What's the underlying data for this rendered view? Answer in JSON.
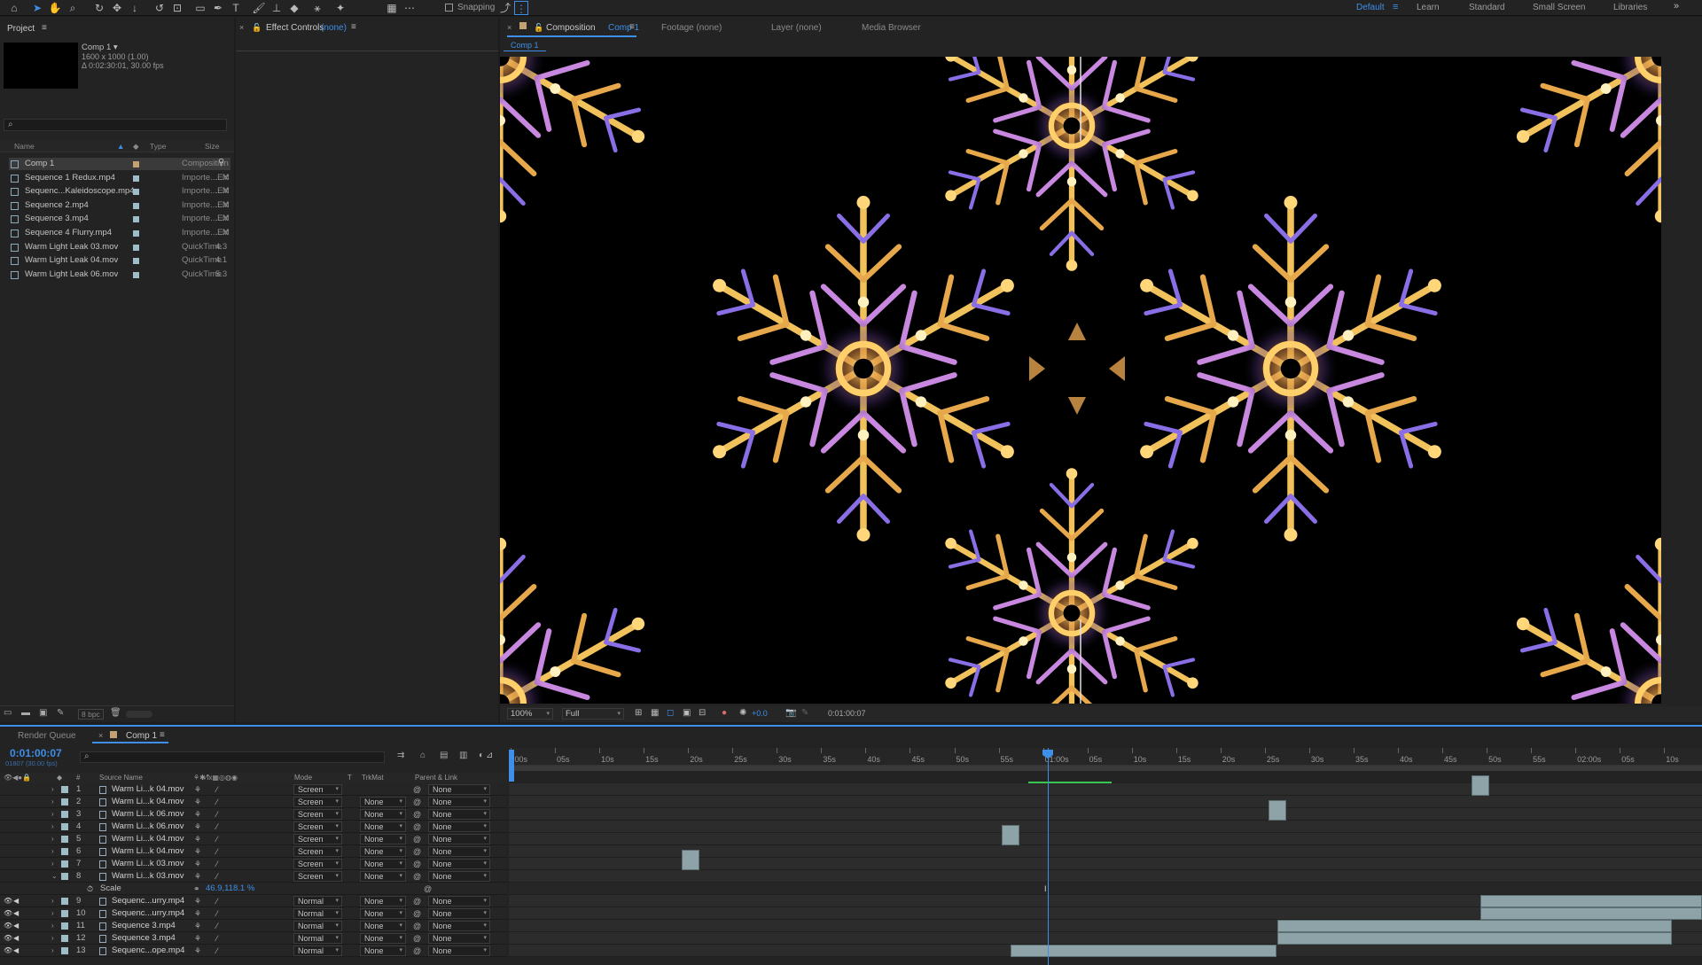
{
  "toolbar": {
    "snapping_label": "Snapping",
    "workspaces": [
      "Default",
      "Learn",
      "Standard",
      "Small Screen",
      "Libraries"
    ],
    "active_workspace": "Default"
  },
  "project": {
    "tab_label": "Project",
    "comp_name": "Comp 1 ▾",
    "comp_size": "1600 x 1000 (1.00)",
    "comp_duration": "Δ 0:02:30:01, 30.00 fps",
    "columns": {
      "name": "Name",
      "type": "Type",
      "size": "Size"
    },
    "items": [
      {
        "name": "Comp 1",
        "type": "Composition",
        "size": ""
      },
      {
        "name": "Sequence 1 Redux.mp4",
        "type": "Importe...EX",
        "size": "...M"
      },
      {
        "name": "Sequenc...Kaleidoscope.mp4",
        "type": "Importe...EX",
        "size": "...M"
      },
      {
        "name": "Sequence 2.mp4",
        "type": "Importe...EX",
        "size": "...M"
      },
      {
        "name": "Sequence 3.mp4",
        "type": "Importe...EX",
        "size": "...M"
      },
      {
        "name": "Sequence 4 Flurry.mp4",
        "type": "Importe...EX",
        "size": "...M"
      },
      {
        "name": "Warm Light Leak 03.mov",
        "type": "QuickTime",
        "size": "4.3"
      },
      {
        "name": "Warm Light Leak 04.mov",
        "type": "QuickTime",
        "size": "4.1"
      },
      {
        "name": "Warm Light Leak 06.mov",
        "type": "QuickTime",
        "size": "5.3"
      }
    ],
    "bpc": "8 bpc"
  },
  "effect_controls": {
    "tab_label": "Effect Controls",
    "target": "(none)"
  },
  "composition": {
    "tab_label": "Composition",
    "tab_comp": "Comp 1",
    "breadcrumb": "Comp 1",
    "other_tabs": [
      "Footage (none)",
      "Layer (none)",
      "Media Browser"
    ],
    "zoom": "100%",
    "resolution": "Full",
    "exposure": "+0.0",
    "timecode": "0:01:00:07"
  },
  "timeline": {
    "tabs": [
      "Render Queue",
      "Comp 1"
    ],
    "current_time": "0:01:00:07",
    "frame_info": "01807 (30.00 fps)",
    "columns": {
      "source": "Source Name",
      "mode": "Mode",
      "t": "T",
      "trkmat": "TrkMat",
      "parent": "Parent & Link"
    },
    "ruler_labels": [
      ":00s",
      "05s",
      "10s",
      "15s",
      "20s",
      "25s",
      "30s",
      "35s",
      "40s",
      "45s",
      "50s",
      "55s",
      "01:00s",
      "05s",
      "10s",
      "15s",
      "20s",
      "25s",
      "30s",
      "35s",
      "40s",
      "45s",
      "50s",
      "55s",
      "02:00s",
      "05s",
      "10s"
    ],
    "layers": [
      {
        "num": "1",
        "name": "Warm Li...k 04.mov",
        "mode": "Screen",
        "trkmat": "",
        "parent": "None"
      },
      {
        "num": "2",
        "name": "Warm Li...k 04.mov",
        "mode": "Screen",
        "trkmat": "None",
        "parent": "None"
      },
      {
        "num": "3",
        "name": "Warm Li...k 06.mov",
        "mode": "Screen",
        "trkmat": "None",
        "parent": "None"
      },
      {
        "num": "4",
        "name": "Warm Li...k 06.mov",
        "mode": "Screen",
        "trkmat": "None",
        "parent": "None"
      },
      {
        "num": "5",
        "name": "Warm Li...k 04.mov",
        "mode": "Screen",
        "trkmat": "None",
        "parent": "None"
      },
      {
        "num": "6",
        "name": "Warm Li...k 04.mov",
        "mode": "Screen",
        "trkmat": "None",
        "parent": "None"
      },
      {
        "num": "7",
        "name": "Warm Li...k 03.mov",
        "mode": "Screen",
        "trkmat": "None",
        "parent": "None"
      },
      {
        "num": "8",
        "name": "Warm Li...k 03.mov",
        "mode": "Screen",
        "trkmat": "None",
        "parent": "None"
      },
      {
        "num": "9",
        "name": "Sequenc...urry.mp4",
        "mode": "Normal",
        "trkmat": "None",
        "parent": "None"
      },
      {
        "num": "10",
        "name": "Sequenc...urry.mp4",
        "mode": "Normal",
        "trkmat": "None",
        "parent": "None"
      },
      {
        "num": "11",
        "name": "Sequence 3.mp4",
        "mode": "Normal",
        "trkmat": "None",
        "parent": "None"
      },
      {
        "num": "12",
        "name": "Sequence 3.mp4",
        "mode": "Normal",
        "trkmat": "None",
        "parent": "None"
      },
      {
        "num": "13",
        "name": "Sequenc...ope.mp4",
        "mode": "Normal",
        "trkmat": "None",
        "parent": "None"
      }
    ],
    "scale_property": {
      "label": "Scale",
      "value": "46.9,118.1 %"
    }
  }
}
